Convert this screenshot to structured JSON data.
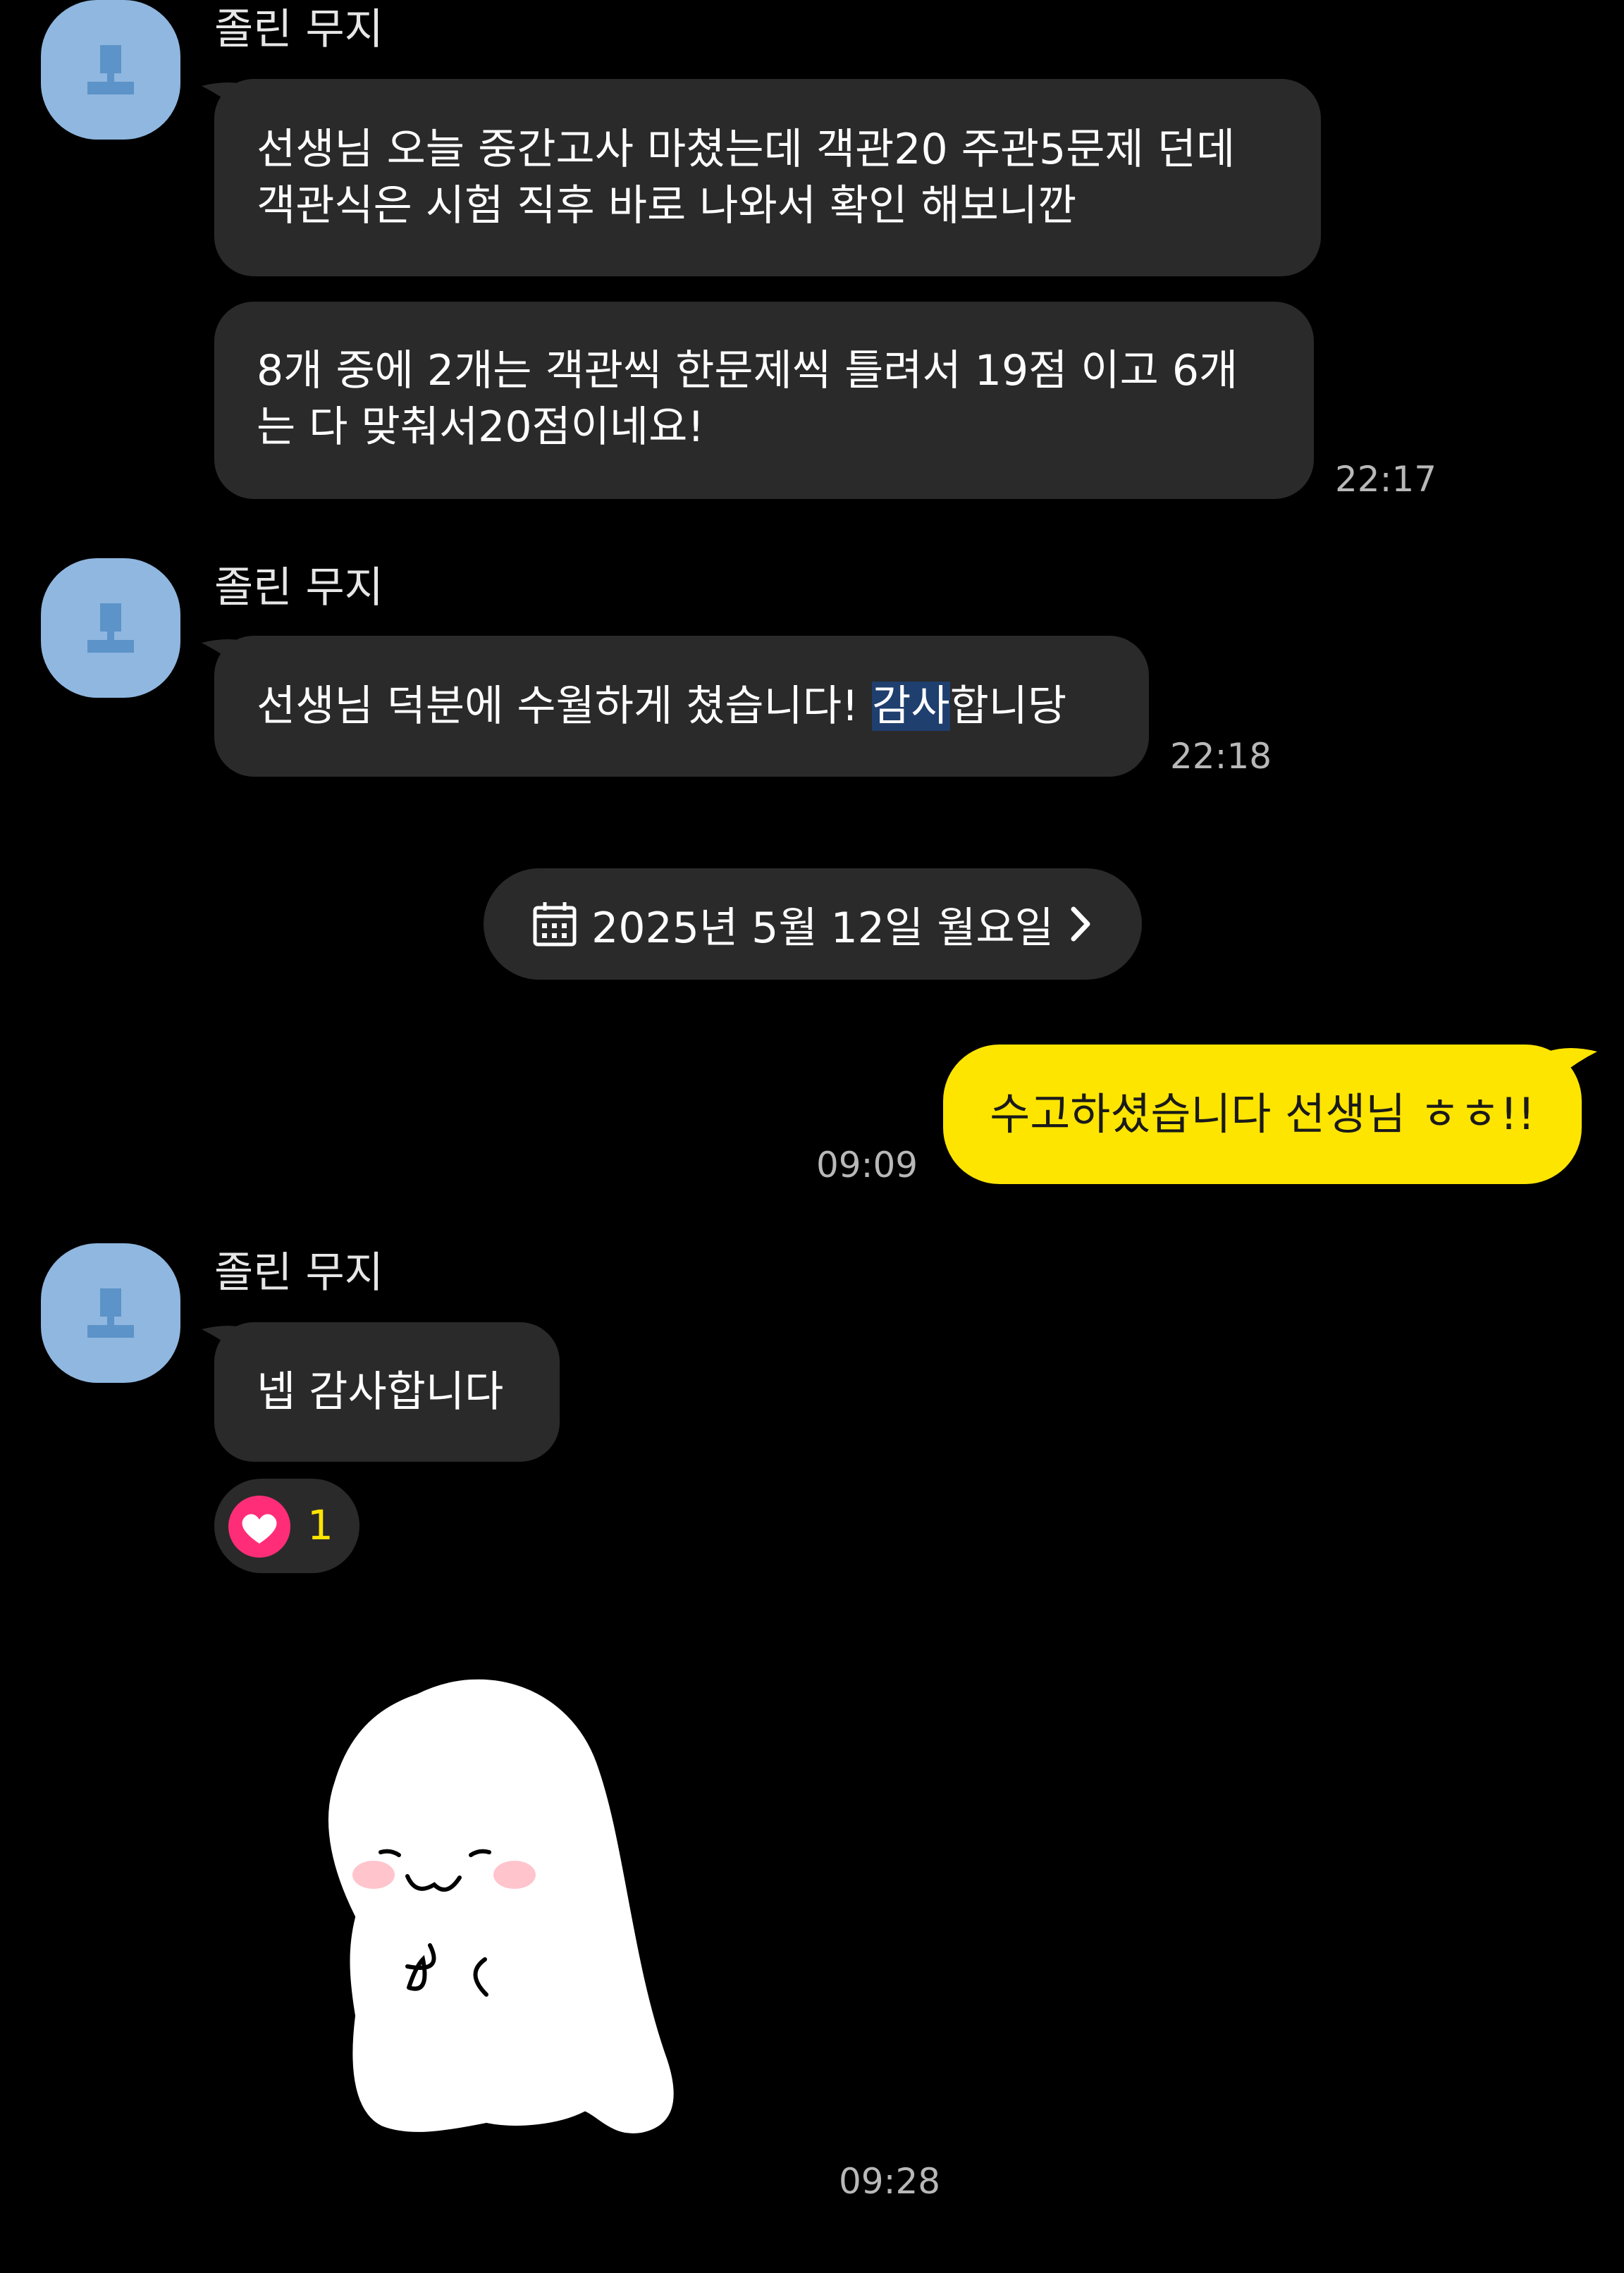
{
  "contact_name": "졸린 무지",
  "groups": [
    {
      "sender": "졸린 무지",
      "messages": [
        {
          "lines": [
            "선생님 오늘 중간고사 마쳤는데 객관20 주관5문제 던데",
            "객관식은 시험 직후 바로 나와서 확인 해보니깐"
          ]
        },
        {
          "lines": [
            "8개 중에 2개는 객관씩 한문제씩 틀려서 19점 이고 6개",
            "는 다 맞춰서20점이네요!"
          ],
          "time": "22:17"
        }
      ]
    },
    {
      "sender": "졸린 무지",
      "messages": [
        {
          "before": "선생님 덕분에 수월하게 쳤습니다! ",
          "highlight": "감사",
          "after": "합니당",
          "time": "22:18"
        }
      ]
    }
  ],
  "date_divider": {
    "label": "2025년 5월 12일 월요일",
    "icon": "calendar-icon",
    "chevron": "chevron-right-icon"
  },
  "my_message": {
    "text": "수고하셨습니다 선생님 ㅎㅎ!!",
    "time": "09:09"
  },
  "group3": {
    "sender": "졸린 무지",
    "message": "넵 감사합니다",
    "reaction": {
      "icon": "heart-icon",
      "count": "1"
    },
    "sticker": {
      "icon": "white-ghost-sticker",
      "time": "09:28"
    }
  },
  "colors": {
    "background": "#000000",
    "bubble_other": "#2a2a2a",
    "bubble_mine": "#fee500",
    "avatar": "#8fb7e0",
    "reaction_heart": "#ff2d78",
    "reaction_count": "#fee500",
    "highlight": "#1f3f6e"
  }
}
